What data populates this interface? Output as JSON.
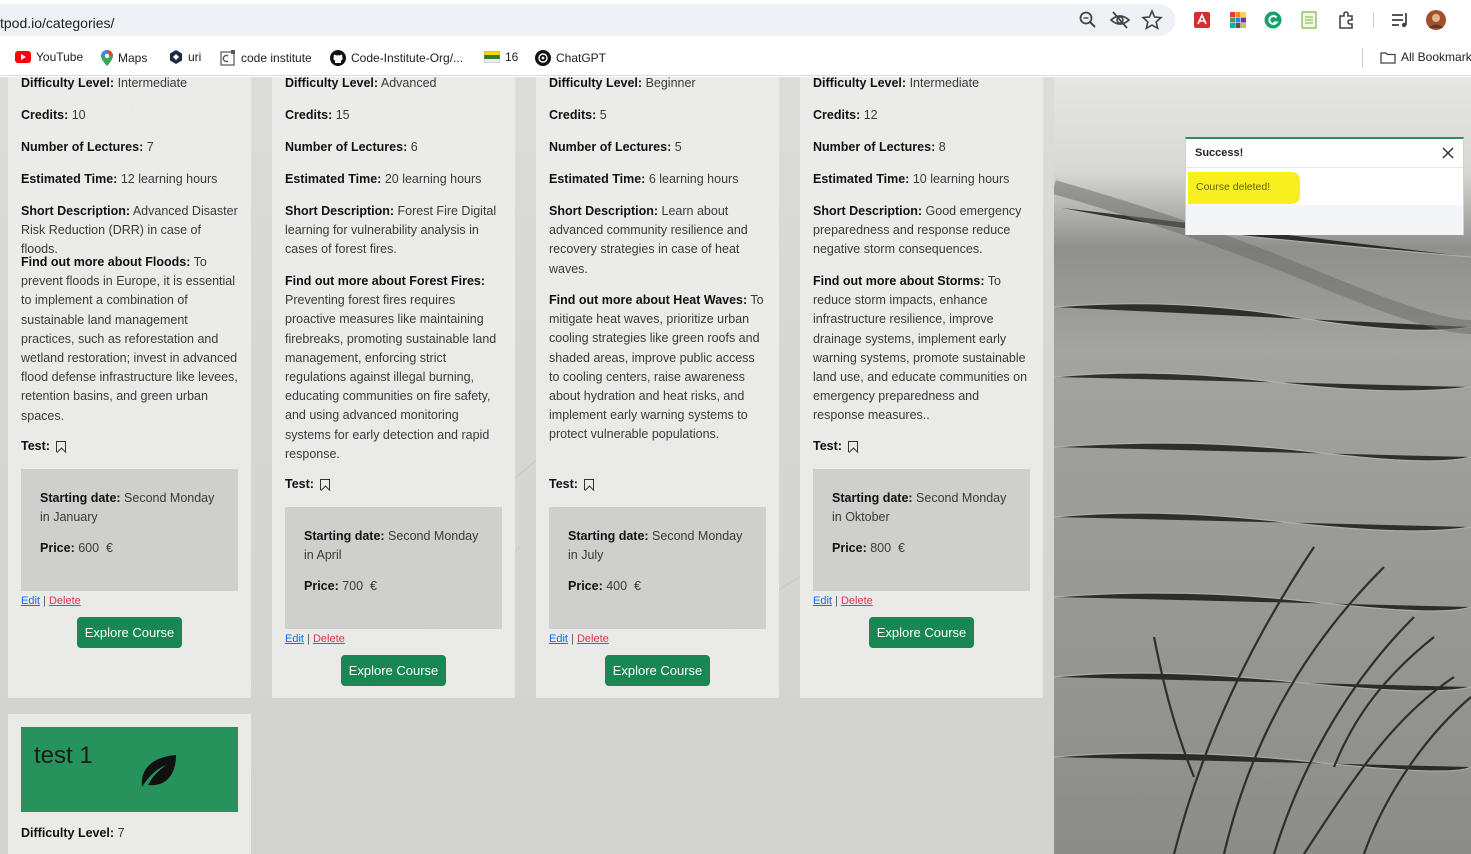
{
  "browser": {
    "url": "tpod.io/categories/",
    "bookmarks": [
      {
        "label": "YouTube",
        "icon": "youtube-icon"
      },
      {
        "label": "Maps",
        "icon": "maps-pin-icon"
      },
      {
        "label": "uri",
        "icon": "uri-icon"
      },
      {
        "label": "code institute",
        "icon": "code-institute-icon"
      },
      {
        "label": "Code-Institute-Org/...",
        "icon": "github-icon"
      },
      {
        "label": "16",
        "icon": "flag-icon"
      },
      {
        "label": "ChatGPT",
        "icon": "chatgpt-icon"
      }
    ],
    "all_bookmarks": "All Bookmarks"
  },
  "labels": {
    "difficulty": "Difficulty Level:",
    "credits": "Credits:",
    "lectures": "Number of Lectures:",
    "time": "Estimated Time:",
    "short_desc": "Short Description:",
    "test": "Test:",
    "starting": "Starting date:",
    "price": "Price:",
    "currency": "€",
    "edit": "Edit",
    "sep": "|",
    "delete": "Delete",
    "explore": "Explore Course"
  },
  "courses": [
    {
      "difficulty": "Intermediate",
      "credits": "10",
      "lectures": "7",
      "time": "12 learning hours",
      "short_desc": "Advanced Disaster Risk Reduction (DRR) in case of floods.",
      "find_more_label": "Find out more about Floods:",
      "find_more": "To prevent floods in Europe, it is essential to implement a combination of sustainable land management practices, such as reforestation and wetland restoration; invest in advanced flood defense infrastructure like levees, retention basins, and green urban spaces.",
      "starting": "Second Monday in January",
      "price": "600"
    },
    {
      "difficulty": "Advanced",
      "credits": "15",
      "lectures": "6",
      "time": "20 learning hours",
      "short_desc": "Forest Fire Digital learning for vulnerability analysis in cases of forest fires.",
      "find_more_label": "Find out more about Forest Fires:",
      "find_more": "Preventing forest fires requires proactive measures like maintaining firebreaks, promoting sustainable land management, enforcing strict regulations against illegal burning, educating communities on fire safety, and using advanced monitoring systems for early detection and rapid response.",
      "starting": "Second Monday in April",
      "price": "700"
    },
    {
      "difficulty": "Beginner",
      "credits": "5",
      "lectures": "5",
      "time": "6 learning hours",
      "short_desc": "Learn about advanced community resilience and recovery strategies in case of heat waves.",
      "find_more_label": "Find out more about Heat Waves:",
      "find_more": "To mitigate heat waves, prioritize urban cooling strategies like green roofs and shaded areas, improve public access to cooling centers, raise awareness about hydration and heat risks, and implement early warning systems to protect vulnerable populations.",
      "starting": "Second Monday in July",
      "price": "400"
    },
    {
      "difficulty": "Intermediate",
      "credits": "12",
      "lectures": "8",
      "time": "10 learning hours",
      "short_desc": "Good emergency preparedness and response reduce negative storm consequences.",
      "find_more_label": "Find out more about Storms:",
      "find_more": "To reduce storm impacts, enhance infrastructure resilience, improve drainage systems, implement early warning systems, promote sustainable land use, and educate communities on emergency preparedness and response measures..",
      "starting": "Second Monday in Oktober",
      "price": "800"
    }
  ],
  "test_course": {
    "title": "test 1",
    "difficulty": "7"
  },
  "toast": {
    "title": "Success!",
    "message": "Course deleted!"
  }
}
